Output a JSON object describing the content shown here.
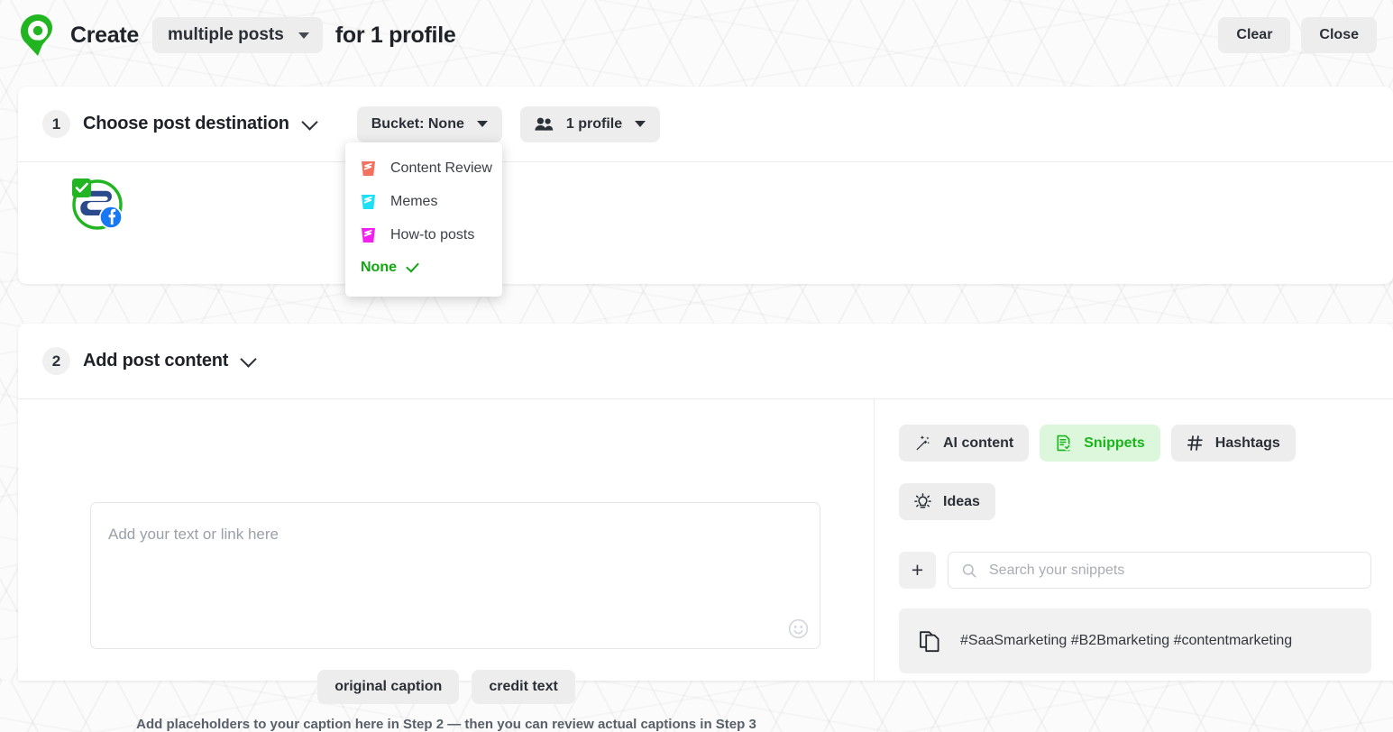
{
  "brand": {
    "logo_icon": "map-pin-logo",
    "green": "#22b522",
    "bright_green": "#19b619",
    "dark_green": "#13a613"
  },
  "topbar": {
    "create_label": "Create",
    "post_type": {
      "value": "multiple posts",
      "caret_icon": "caret-down-icon"
    },
    "for_label": "for 1 profile",
    "clear_label": "Clear",
    "close_label": "Close"
  },
  "step1": {
    "number": "1",
    "title": "Choose post destination",
    "chevron_icon": "chevron-down-icon",
    "bucket_pill": {
      "label": "Bucket: None",
      "caret_icon": "caret-down-icon"
    },
    "profile_pill": {
      "label": "1 profile",
      "people_icon": "people-icon",
      "caret_icon": "caret-down-icon"
    },
    "avatar": {
      "icon": "profile-avatar",
      "network_icon": "facebook-icon",
      "selected_icon": "check-badge-icon"
    }
  },
  "bucket_dropdown": {
    "items": [
      {
        "label": "Content Review",
        "icon": "bucket-icon",
        "color": "#f4705f",
        "selected": false
      },
      {
        "label": "Memes",
        "icon": "bucket-icon",
        "color": "#1ee0f5",
        "selected": false
      },
      {
        "label": "How-to posts",
        "icon": "bucket-icon",
        "color": "#f41ef0",
        "selected": false
      },
      {
        "label": "None",
        "icon": "",
        "color": "",
        "selected": true
      }
    ],
    "check_icon": "check-icon"
  },
  "step2": {
    "number": "2",
    "title": "Add post content",
    "chevron_icon": "chevron-down-icon",
    "composer": {
      "placeholder": "Add your text or link here",
      "value": "",
      "emoji_icon": "emoji-smiley-icon"
    },
    "placeholder_buttons": [
      {
        "label": "original caption"
      },
      {
        "label": "credit text"
      }
    ],
    "placeholder_hint": "Add placeholders to your caption here in Step 2 — then you can review actual captions in Step 3"
  },
  "tools": {
    "buttons": [
      {
        "label": "AI content",
        "icon": "magic-wand-icon",
        "active": false
      },
      {
        "label": "Snippets",
        "icon": "snippet-doc-icon",
        "active": true
      },
      {
        "label": "Hashtags",
        "icon": "hashtag-icon",
        "active": false
      },
      {
        "label": "Ideas",
        "icon": "lightbulb-icon",
        "active": false
      }
    ]
  },
  "snippets": {
    "add_label": "+",
    "search_placeholder": "Search your snippets",
    "search_value": "",
    "search_icon": "search-icon",
    "items": [
      {
        "text": "#SaaSmarketing #B2Bmarketing #contentmarketing",
        "icon": "copy-icon"
      }
    ]
  }
}
